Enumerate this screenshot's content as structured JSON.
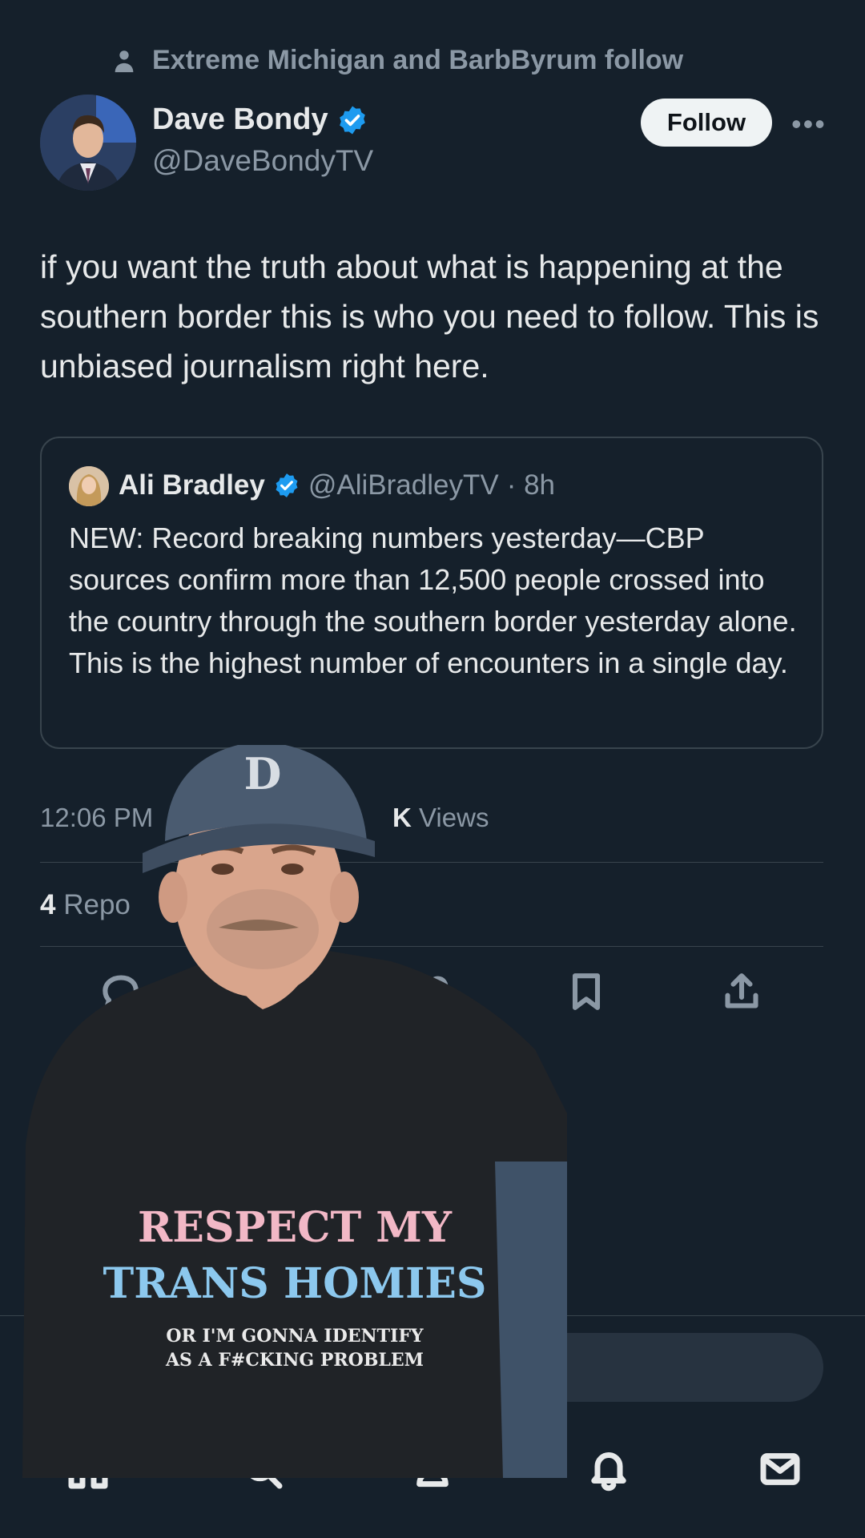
{
  "social_context": {
    "text": "Extreme Michigan and BarbByrum follow",
    "icon": "person-icon"
  },
  "author": {
    "name": "Dave Bondy",
    "handle": "@DaveBondyTV",
    "verified": true
  },
  "follow_button": "Follow",
  "more_icon": "more-icon",
  "tweet": {
    "text": "if you want the truth about what is happening at the southern border this is who you need to follow. This is unbiased journalism right here."
  },
  "quoted_tweet": {
    "name": "Ali Bradley",
    "handle": "@AliBradleyTV",
    "time": "· 8h",
    "text": "NEW: Record breaking numbers yesterday—CBP sources confirm more than 12,500 people crossed into the country through the southern border yesterday alone. This is the highest number of encounters in a single day."
  },
  "metadata": {
    "time": "12:06 PM",
    "views_count": "K",
    "views_label": "Views"
  },
  "stats": {
    "reposts_count": "4",
    "reposts_label": "Repo"
  },
  "actions": [
    "reply-icon",
    "like-icon",
    "bookmark-icon",
    "share-icon"
  ],
  "bottom_nav": [
    "home-icon",
    "search-icon",
    "communities-icon",
    "notifications-icon",
    "messages-icon"
  ],
  "overlay_shirt": {
    "line1": "RESPECT MY",
    "line2": "TRANS HOMIES",
    "line3": "OR I'M GONNA IDENTIFY",
    "line4": "AS A F#CKING PROBLEM"
  },
  "colors": {
    "background": "#15202b",
    "text": "#e7e9ea",
    "secondary": "#8b98a5",
    "verified": "#1d9bf0",
    "border": "#38444d"
  }
}
